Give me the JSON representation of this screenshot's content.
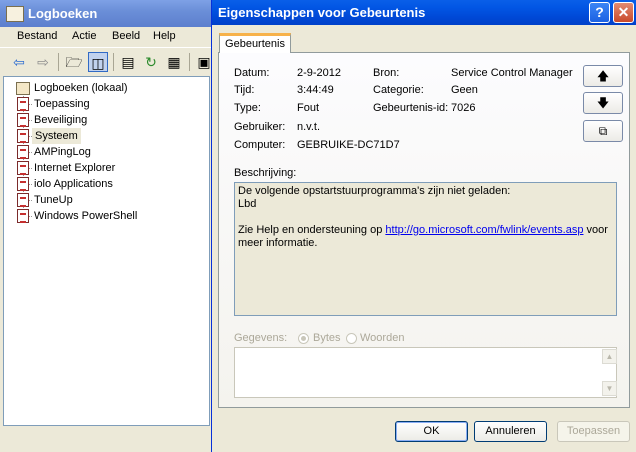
{
  "background_window": {
    "title": "Logboeken",
    "menu": [
      "Bestand",
      "Actie",
      "Beeld",
      "Help"
    ],
    "tree": {
      "root": "Logboeken (lokaal)",
      "items": [
        "Toepassing",
        "Beveiliging",
        "Systeem",
        "AMPingLog",
        "Internet Explorer",
        "iolo Applications",
        "TuneUp",
        "Windows PowerShell"
      ],
      "selected": "Systeem"
    }
  },
  "dialog": {
    "title": "Eigenschappen voor Gebeurtenis",
    "tab": "Gebeurtenis",
    "fields": {
      "datum_label": "Datum:",
      "datum_value": "2-9-2012",
      "tijd_label": "Tijd:",
      "tijd_value": "3:44:49",
      "type_label": "Type:",
      "type_value": "Fout",
      "gebruiker_label": "Gebruiker:",
      "gebruiker_value": "n.v.t.",
      "computer_label": "Computer:",
      "computer_value": "GEBRUIKE-DC71D7",
      "bron_label": "Bron:",
      "bron_value": "Service Control Manager",
      "categorie_label": "Categorie:",
      "categorie_value": "Geen",
      "gebeurtenis_id_label": "Gebeurtenis-id:",
      "gebeurtenis_id_value": "7026"
    },
    "description_label": "Beschrijving:",
    "description": {
      "line1": "De volgende opstartstuurprogramma's zijn niet geladen:",
      "line2": "Lbd",
      "help_prefix": "Zie Help en ondersteuning op ",
      "help_link": "http://go.microsoft.com/fwlink/events.asp",
      "help_suffix": " voor",
      "help_line2": "meer informatie."
    },
    "data_label": "Gegevens:",
    "data_options": [
      "Bytes",
      "Woorden"
    ],
    "data_selected": "Bytes",
    "buttons": {
      "ok": "OK",
      "cancel": "Annuleren",
      "apply": "Toepassen"
    },
    "side_buttons": [
      "up-arrow-icon",
      "down-arrow-icon",
      "copy-icon"
    ],
    "colors": {
      "title_bar": "#0054e3",
      "link": "#0000ee",
      "tab_accent": "#f7b24a"
    }
  }
}
